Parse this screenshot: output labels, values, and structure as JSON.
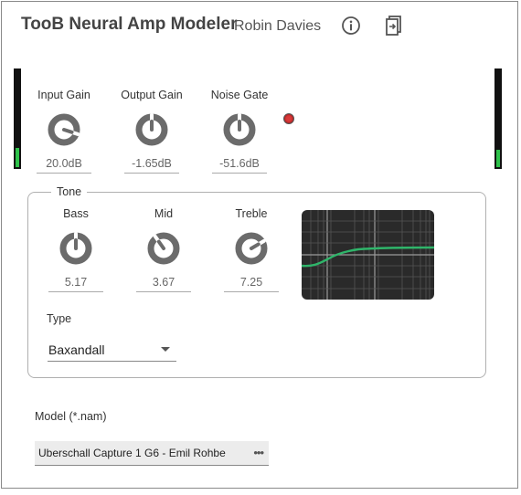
{
  "header": {
    "title": "TooB Neural Amp Modeler",
    "author": "Robin Davies",
    "info_icon": "info-icon",
    "preset_icon": "preset-load-icon"
  },
  "meters": {
    "input_level": 0.2,
    "output_level": 0.18,
    "fill_color": "#2ec24a"
  },
  "controls": {
    "input_gain": {
      "label": "Input Gain",
      "value": "20.0dB",
      "level": 0.9
    },
    "output_gain": {
      "label": "Output Gain",
      "value": "-1.65dB",
      "level": 0.5
    },
    "noise_gate": {
      "label": "Noise Gate",
      "value": "-51.6dB",
      "level": 0.5
    },
    "gate_led_color": "#d93a3a"
  },
  "tone": {
    "legend": "Tone",
    "bass": {
      "label": "Bass",
      "value": "5.17",
      "level": 0.5
    },
    "mid": {
      "label": "Mid",
      "value": "3.67",
      "level": 0.37
    },
    "treble": {
      "label": "Treble",
      "value": "7.25",
      "level": 0.72
    },
    "curve_color": "#2fb56a",
    "type_label": "Type",
    "type_value": "Baxandall"
  },
  "model": {
    "label": "Model (*.nam)",
    "value": "Uberschall Capture 1 G6 - Emil Rohbe",
    "more_icon": "more-dots-icon"
  },
  "colors": {
    "knob": "#6b6b6b",
    "knob_pointer": "#ffffff"
  }
}
